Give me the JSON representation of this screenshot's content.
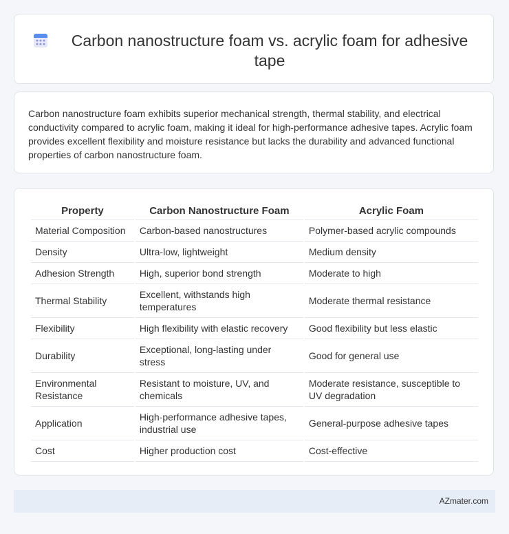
{
  "header": {
    "title": "Carbon nanostructure foam vs. acrylic foam for adhesive tape",
    "icon": "calendar-grid-icon",
    "icon_colors": {
      "top": "#5b8def",
      "body": "#e3e6f8",
      "dots": "#8a8fd6"
    }
  },
  "summary": {
    "text": "Carbon nanostructure foam exhibits superior mechanical strength, thermal stability, and electrical conductivity compared to acrylic foam, making it ideal for high-performance adhesive tapes. Acrylic foam provides excellent flexibility and moisture resistance but lacks the durability and advanced functional properties of carbon nanostructure foam."
  },
  "table": {
    "headers": [
      "Property",
      "Carbon Nanostructure Foam",
      "Acrylic Foam"
    ],
    "rows": [
      [
        "Material Composition",
        "Carbon-based nanostructures",
        "Polymer-based acrylic compounds"
      ],
      [
        "Density",
        "Ultra-low, lightweight",
        "Medium density"
      ],
      [
        "Adhesion Strength",
        "High, superior bond strength",
        "Moderate to high"
      ],
      [
        "Thermal Stability",
        "Excellent, withstands high temperatures",
        "Moderate thermal resistance"
      ],
      [
        "Flexibility",
        "High flexibility with elastic recovery",
        "Good flexibility but less elastic"
      ],
      [
        "Durability",
        "Exceptional, long-lasting under stress",
        "Good for general use"
      ],
      [
        "Environmental Resistance",
        "Resistant to moisture, UV, and chemicals",
        "Moderate resistance, susceptible to UV degradation"
      ],
      [
        "Application",
        "High-performance adhesive tapes, industrial use",
        "General-purpose adhesive tapes"
      ],
      [
        "Cost",
        "Higher production cost",
        "Cost-effective"
      ]
    ]
  },
  "footer": {
    "brand": "AZmater.com"
  }
}
